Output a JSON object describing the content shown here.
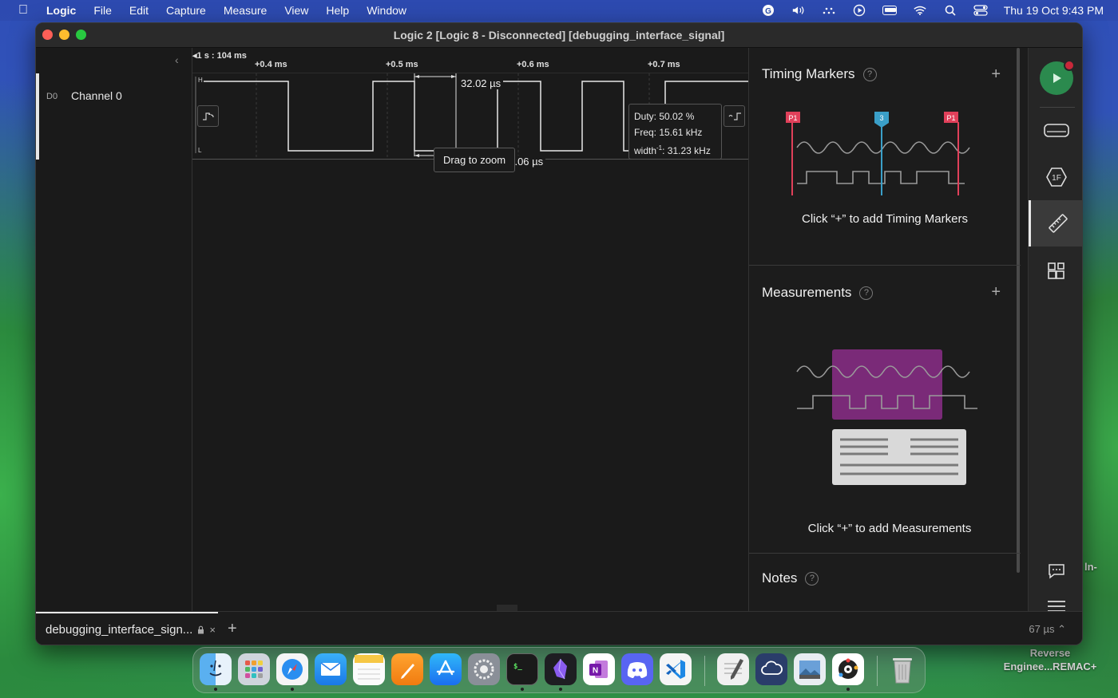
{
  "menubar": {
    "items": [
      "Logic",
      "File",
      "Edit",
      "Capture",
      "Measure",
      "View",
      "Help",
      "Window"
    ],
    "datetime": "Thu 19 Oct  9:43 PM"
  },
  "window": {
    "title": "Logic 2 [Logic 8 - Disconnected] [debugging_interface_signal]"
  },
  "timeline": {
    "origin": "1 s : 104 ms",
    "ticks": [
      "+0.4 ms",
      "+0.5 ms",
      "+0.6 ms",
      "+0.7 ms"
    ]
  },
  "channel": {
    "id": "D0",
    "name": "Channel 0",
    "high_label": "H",
    "low_label": "L"
  },
  "measurement": {
    "pulse_width": "32.02 µs",
    "period": "64.06 µs",
    "zoom_hint": "Drag to zoom",
    "duty": "Duty: 50.02 %",
    "freq": "Freq: 15.61 kHz",
    "width_inv_prefix": "width",
    "width_inv_sup": "-1",
    "width_inv_value": ": 31.23 kHz"
  },
  "side_panel": {
    "timing": {
      "title": "Timing Markers",
      "hint": "Click “+” to add Timing Markers",
      "marker_labels": [
        "P1",
        "3",
        "P1"
      ]
    },
    "measurements": {
      "title": "Measurements",
      "hint": "Click “+” to add Measurements"
    },
    "notes": {
      "title": "Notes"
    }
  },
  "tabbar": {
    "tab_label": "debugging_interface_sign...",
    "time_indicator": "67 µs"
  },
  "desktop": {
    "label_partial": "ln-",
    "label_line1": "Reverse",
    "label_line2": "Enginee...REMAC+"
  },
  "colors": {
    "accent_green": "#2b8a4e",
    "marker_red": "#e0405a",
    "marker_blue": "#3a9fc8",
    "measure_purple": "#7a2a78"
  },
  "dock_apps": [
    "finder",
    "launchpad",
    "safari",
    "mail",
    "notes",
    "pages",
    "app-store",
    "system-settings",
    "terminal",
    "obsidian",
    "onenote",
    "discord",
    "vscode",
    "script-editor",
    "cloud-app",
    "preview",
    "davinci",
    "trash"
  ]
}
